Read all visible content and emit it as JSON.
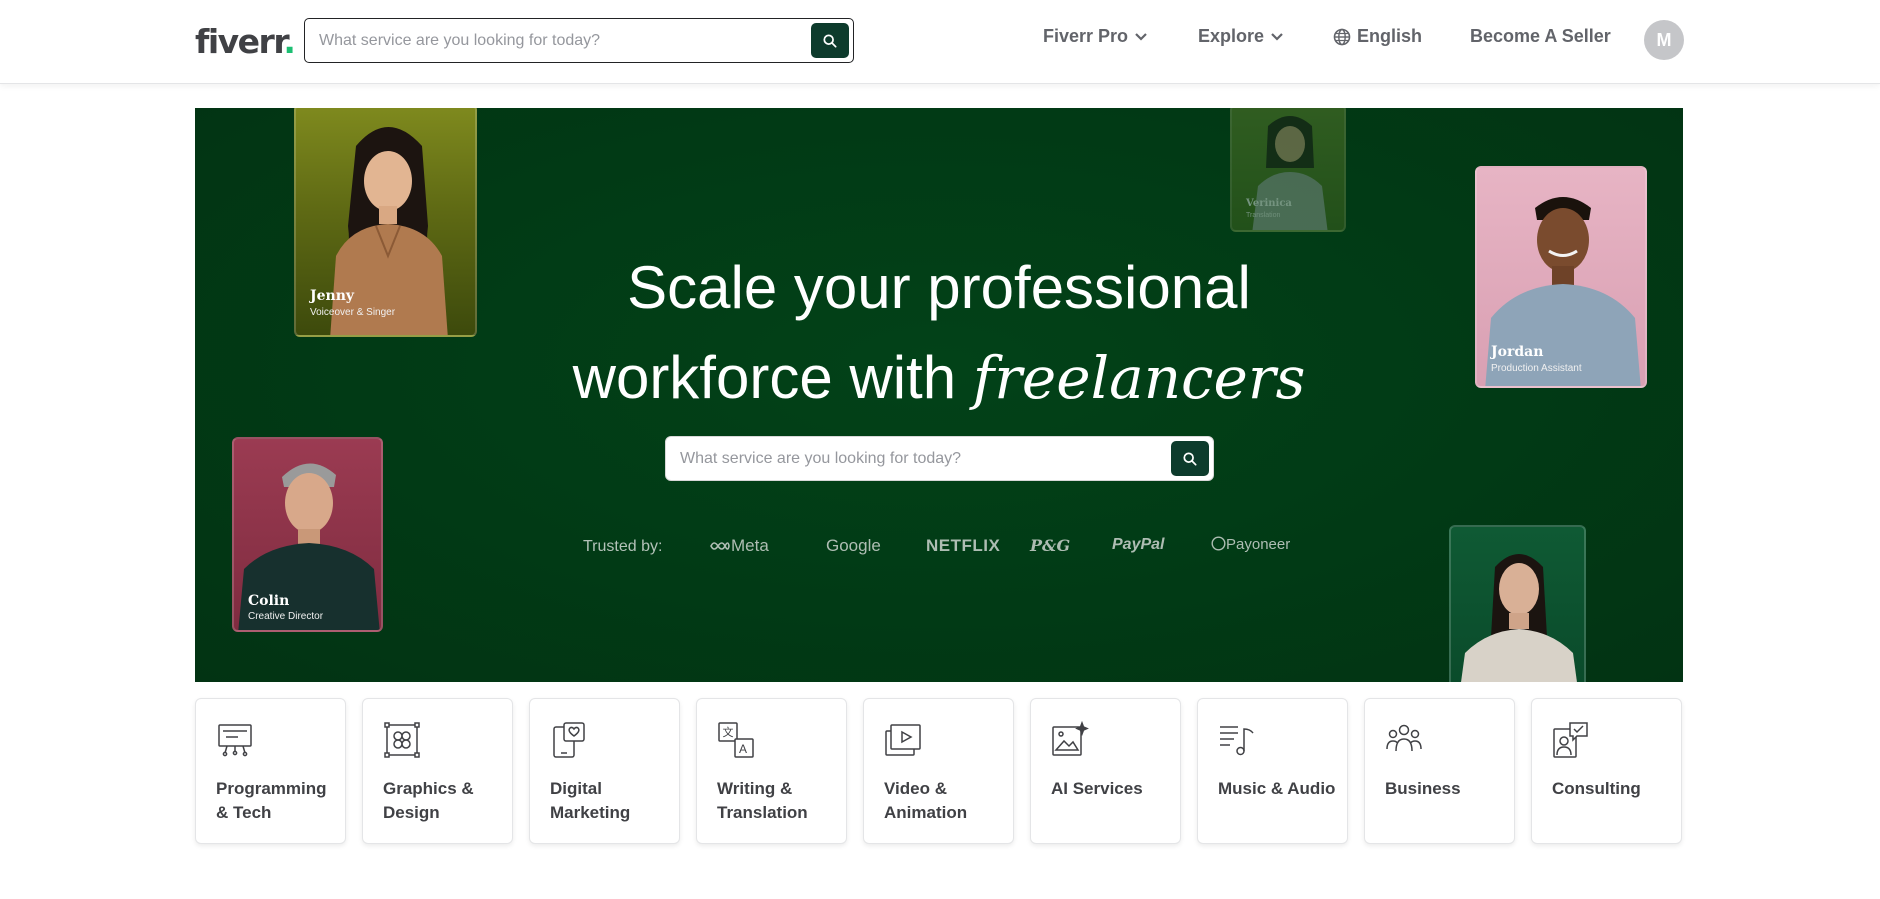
{
  "header": {
    "logo_text": "fiverr",
    "logo_dot": ".",
    "search_placeholder": "What service are you looking for today?",
    "nav": {
      "fiverr_pro": "Fiverr Pro",
      "explore": "Explore",
      "language": "English",
      "become_seller": "Become A Seller"
    },
    "avatar_initial": "M"
  },
  "hero": {
    "title_line1": "Scale your professional",
    "title_line2_plain": "workforce with ",
    "title_line2_italic": "freelancers",
    "search_placeholder": "What service are you looking for today?",
    "trusted_label": "Trusted by:",
    "brands": [
      "Meta",
      "Google",
      "NETFLIX",
      "P&G",
      "PayPal",
      "Payoneer"
    ],
    "freelancers": [
      {
        "name": "Jenny",
        "role": "Voiceover & Singer"
      },
      {
        "name": "Verinica",
        "role": "Translation"
      },
      {
        "name": "Jordan",
        "role": "Production Assistant"
      },
      {
        "name": "Colin",
        "role": "Creative Director"
      }
    ]
  },
  "categories": [
    {
      "label": "Programming & Tech",
      "icon": "presentation-board-icon"
    },
    {
      "label": "Graphics & Design",
      "icon": "design-frame-icon"
    },
    {
      "label": "Digital Marketing",
      "icon": "tablet-heart-icon"
    },
    {
      "label": "Writing & Translation",
      "icon": "translate-icon"
    },
    {
      "label": "Video & Animation",
      "icon": "video-play-icon"
    },
    {
      "label": "AI Services",
      "icon": "ai-image-sparkle-icon"
    },
    {
      "label": "Music & Audio",
      "icon": "music-note-icon"
    },
    {
      "label": "Business",
      "icon": "team-people-icon"
    },
    {
      "label": "Consulting",
      "icon": "consulting-chat-icon"
    }
  ],
  "colors": {
    "brand_green": "#1dbf73",
    "hero_bg": "#013a15",
    "search_button": "#0d3b2c",
    "text_dark": "#404145"
  }
}
